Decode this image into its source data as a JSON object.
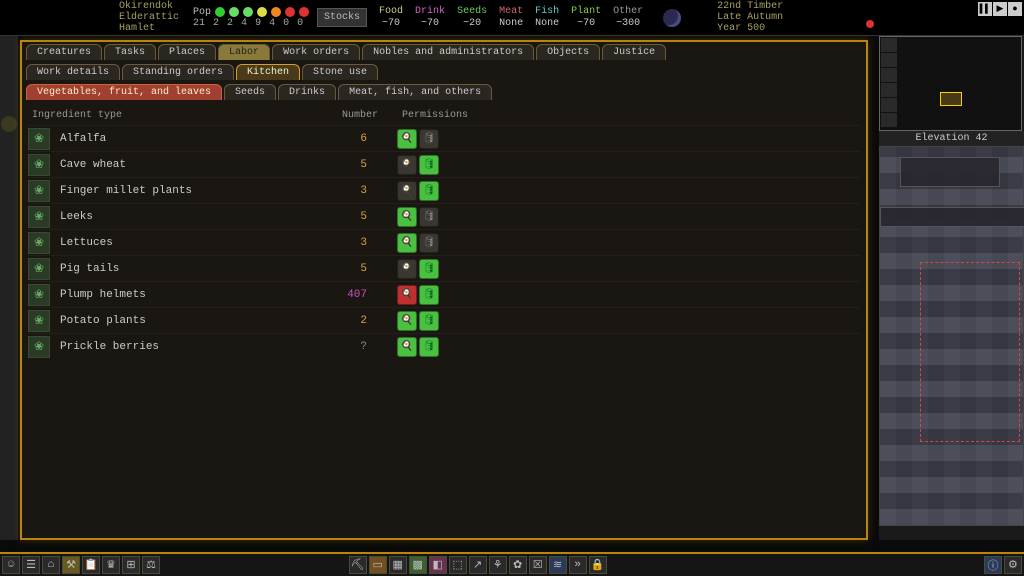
{
  "fortress": {
    "name": "Okirendok",
    "civ": "Elderattic",
    "type": "Hamlet"
  },
  "population": {
    "label": "Pop",
    "total": "21",
    "moods": [
      "2",
      "2",
      "4",
      "9",
      "4",
      "0",
      "0"
    ]
  },
  "stocks_button": "Stocks",
  "resources": {
    "food": {
      "label": "Food",
      "value": "~70"
    },
    "drink": {
      "label": "Drink",
      "value": "~70"
    },
    "seeds": {
      "label": "Seeds",
      "value": "~20"
    },
    "meat": {
      "label": "Meat",
      "value": "None"
    },
    "fish": {
      "label": "Fish",
      "value": "None"
    },
    "plant": {
      "label": "Plant",
      "value": "~70"
    },
    "other": {
      "label": "Other",
      "value": "~300"
    }
  },
  "date": {
    "day": "22nd Timber",
    "season": "Late Autumn",
    "year": "Year 500"
  },
  "tabs_main": [
    "Creatures",
    "Tasks",
    "Places",
    "Labor",
    "Work orders",
    "Nobles and administrators",
    "Objects",
    "Justice"
  ],
  "tabs_sub": [
    "Work details",
    "Standing orders",
    "Kitchen",
    "Stone use"
  ],
  "tabs_kit": [
    "Vegetables, fruit, and leaves",
    "Seeds",
    "Drinks",
    "Meat, fish, and others"
  ],
  "columns": {
    "type": "Ingredient type",
    "number": "Number",
    "permissions": "Permissions"
  },
  "ingredients": [
    {
      "name": "Alfalfa",
      "num": "6",
      "numcls": "",
      "cook": "green",
      "brew": "dark"
    },
    {
      "name": "Cave wheat",
      "num": "5",
      "numcls": "",
      "cook": "dark",
      "brew": "green"
    },
    {
      "name": "Finger millet plants",
      "num": "3",
      "numcls": "",
      "cook": "dark",
      "brew": "green"
    },
    {
      "name": "Leeks",
      "num": "5",
      "numcls": "",
      "cook": "green",
      "brew": "dark"
    },
    {
      "name": "Lettuces",
      "num": "3",
      "numcls": "",
      "cook": "green",
      "brew": "dark"
    },
    {
      "name": "Pig tails",
      "num": "5",
      "numcls": "",
      "cook": "dark",
      "brew": "green"
    },
    {
      "name": "Plump helmets",
      "num": "407",
      "numcls": "magenta",
      "cook": "red",
      "brew": "green"
    },
    {
      "name": "Potato plants",
      "num": "2",
      "numcls": "",
      "cook": "green",
      "brew": "green"
    },
    {
      "name": "Prickle berries",
      "num": "?",
      "numcls": "gray",
      "cook": "green",
      "brew": "green"
    }
  ],
  "minimap": {
    "elevation": "Elevation 42"
  },
  "icons": {
    "cook": "☕",
    "brew": "🍺"
  }
}
